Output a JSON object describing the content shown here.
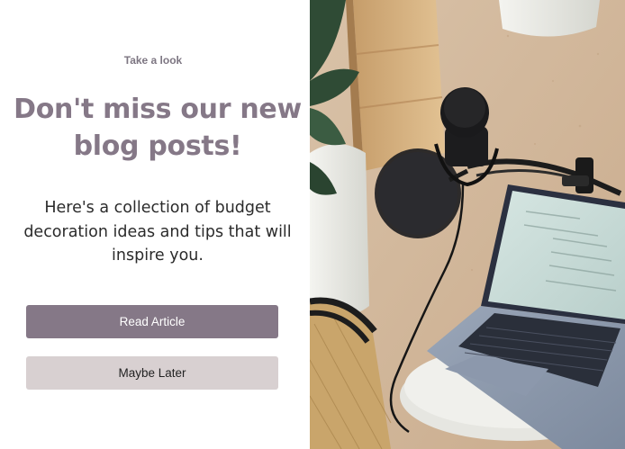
{
  "promo": {
    "eyebrow": "Take a look",
    "title": "Don't miss our new blog posts!",
    "description": "Here's a collection of budget decoration ideas and tips that will inspire you.",
    "primary_button": "Read Article",
    "secondary_button": "Maybe Later"
  },
  "colors": {
    "accent": "#857887",
    "secondary_button_bg": "#d8d0d1"
  }
}
